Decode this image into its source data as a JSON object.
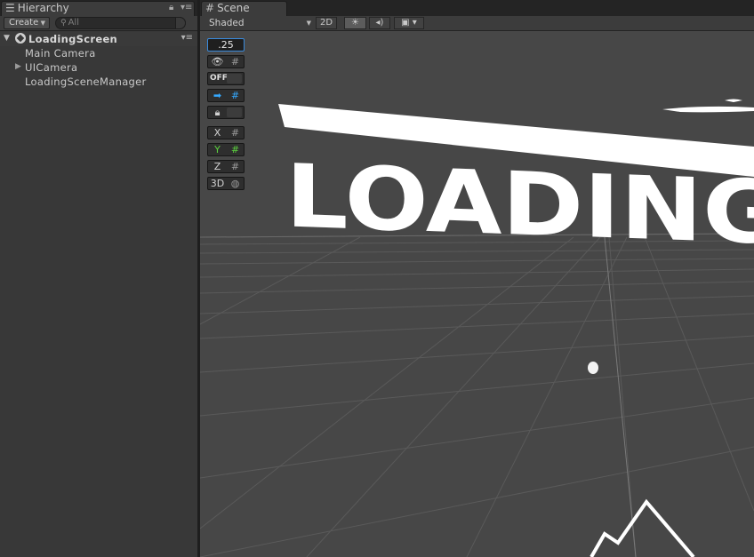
{
  "hierarchy": {
    "tab_label": "Hierarchy",
    "create_label": "Create",
    "search_placeholder": "All",
    "scene_name": "LoadingScreen",
    "items": [
      {
        "label": "Main Camera",
        "has_children": false
      },
      {
        "label": "UICamera",
        "has_children": true
      },
      {
        "label": "LoadingSceneManager",
        "has_children": false
      }
    ]
  },
  "scene": {
    "tab_label": "Scene",
    "shading_mode": "Shaded",
    "mode_2d_label": "2D",
    "snap_value": ".25",
    "grid_off_label": "OFF",
    "axis_x": "X",
    "axis_y": "Y",
    "axis_z": "Z",
    "mode_3d_label": "3D",
    "world_text": "LOADING"
  },
  "colors": {
    "accent_blue": "#35a9ff",
    "axis_green": "#5bd13e",
    "viewport_bg": "#474747",
    "panel_bg": "#383838"
  },
  "icons": [
    "list-icon",
    "lock-icon",
    "menu-icon",
    "search-icon",
    "unity-logo-icon",
    "grid-icon",
    "light-icon",
    "audio-icon",
    "image-effects-icon",
    "eye-icon",
    "arrow-icon"
  ]
}
